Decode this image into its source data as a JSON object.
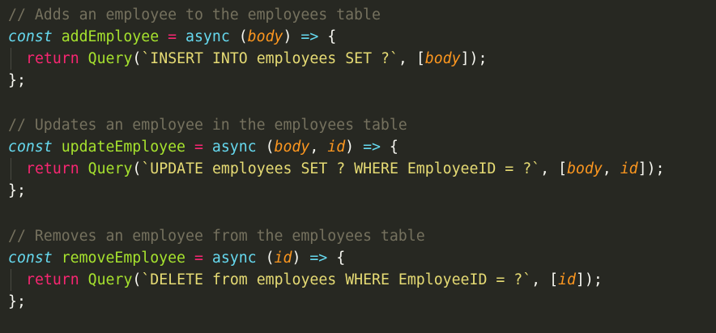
{
  "blocks": [
    {
      "comment": "// Adds an employee to the employees table",
      "decl": "const",
      "name": "addEmployee",
      "eq": "=",
      "async": "async",
      "open_paren": "(",
      "params": [
        {
          "name": "body"
        }
      ],
      "close_paren": ")",
      "arrow": "=>",
      "brace": "{",
      "return": "return",
      "query_fn": "Query",
      "query_open": "(",
      "sql": "`INSERT INTO employees SET ?`",
      "comma": ",",
      "arr_open": "[",
      "args": [
        {
          "name": "body"
        }
      ],
      "arr_close": "]",
      "end_call": ");",
      "close": "};"
    },
    {
      "comment": "// Updates an employee in the employees table",
      "decl": "const",
      "name": "updateEmployee",
      "eq": "=",
      "async": "async",
      "open_paren": "(",
      "params": [
        {
          "name": "body",
          "sep": ","
        },
        {
          "name": "id"
        }
      ],
      "close_paren": ")",
      "arrow": "=>",
      "brace": "{",
      "return": "return",
      "query_fn": "Query",
      "query_open": "(",
      "sql": "`UPDATE employees SET ? WHERE EmployeeID = ?`",
      "comma": ",",
      "arr_open": "[",
      "args": [
        {
          "name": "body",
          "sep": ","
        },
        {
          "name": "id"
        }
      ],
      "arr_close": "]",
      "end_call": ");",
      "close": "};"
    },
    {
      "comment": "// Removes an employee from the employees table",
      "decl": "const",
      "name": "removeEmployee",
      "eq": "=",
      "async": "async",
      "open_paren": "(",
      "params": [
        {
          "name": "id"
        }
      ],
      "close_paren": ")",
      "arrow": "=>",
      "brace": "{",
      "return": "return",
      "query_fn": "Query",
      "query_open": "(",
      "sql": "`DELETE from employees WHERE EmployeeID = ?`",
      "comma": ",",
      "arr_open": "[",
      "args": [
        {
          "name": "id"
        }
      ],
      "arr_close": "]",
      "end_call": ");",
      "close": "};"
    }
  ],
  "colors": {
    "background": "#272822",
    "comment": "#75715e",
    "keyword": "#66d9ef",
    "function_name": "#a6e22e",
    "operator": "#f92672",
    "parameter": "#fd971f",
    "string": "#e6db74",
    "text": "#f8f8f2"
  }
}
